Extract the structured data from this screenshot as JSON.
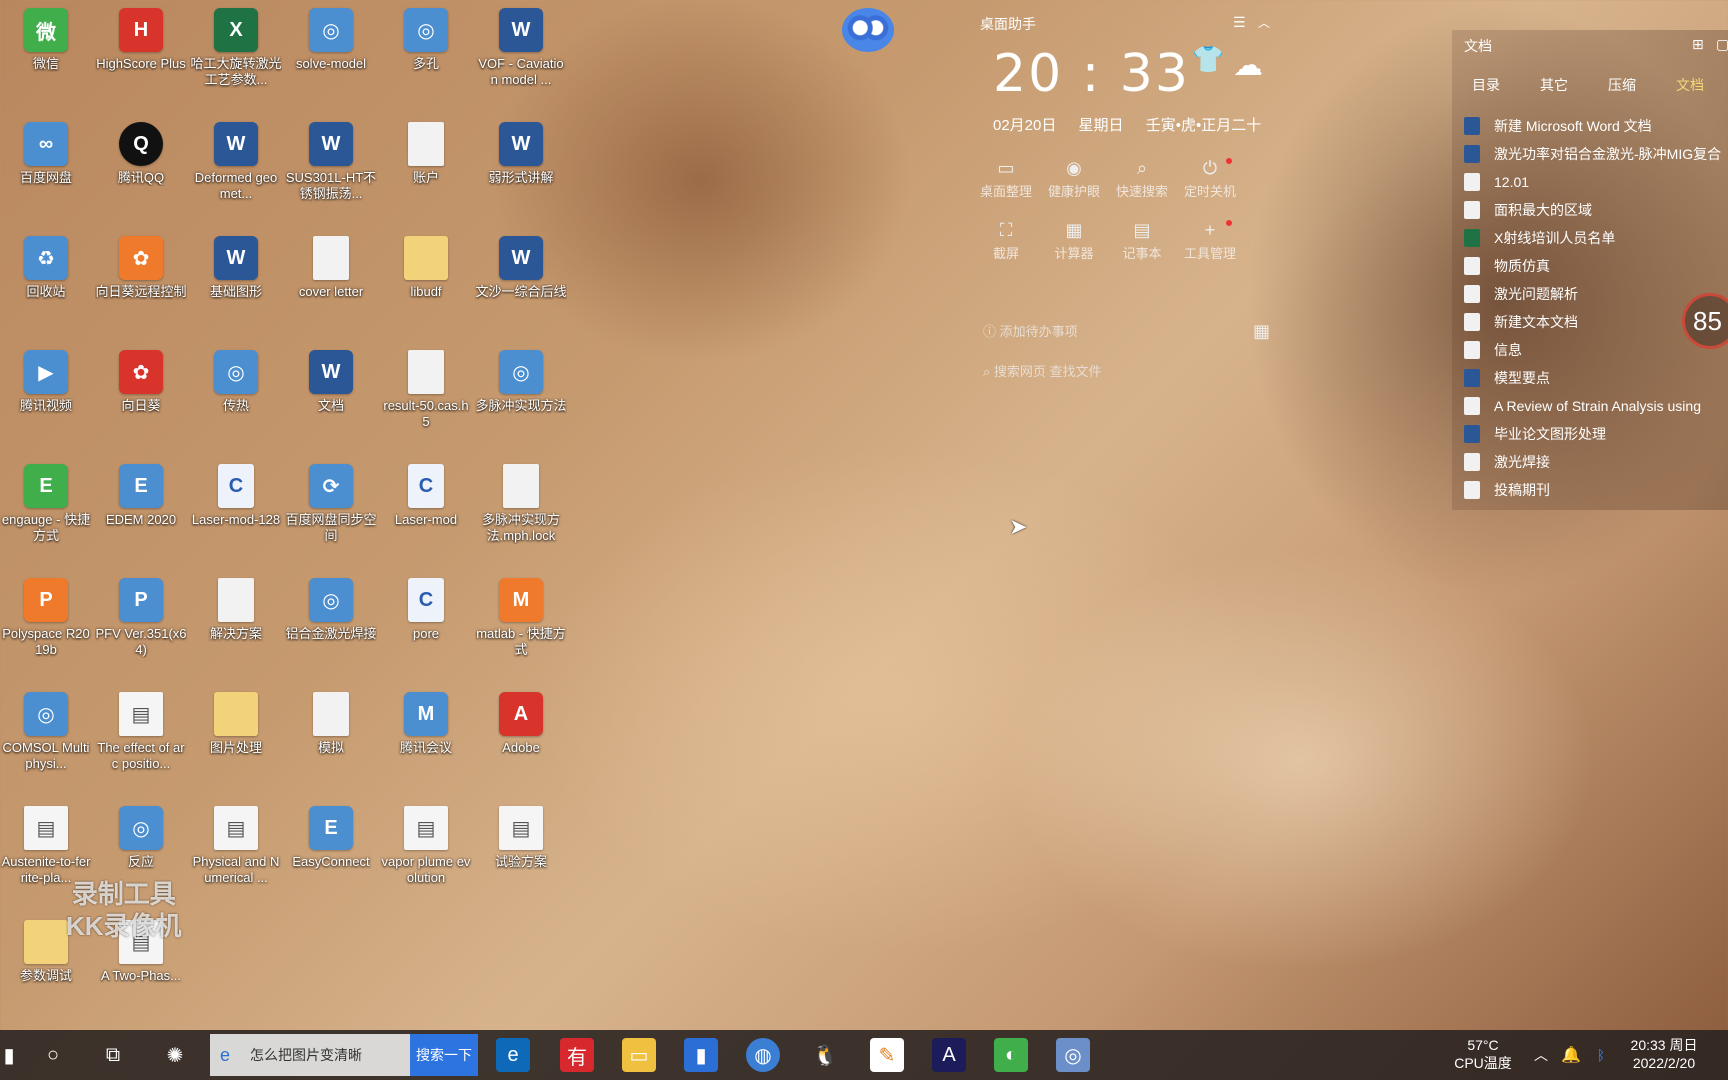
{
  "desktop": {
    "icons": [
      {
        "label": "微信",
        "glyph": "微",
        "kind": "green"
      },
      {
        "label": "HighScore Plus",
        "glyph": "H",
        "kind": "red"
      },
      {
        "label": "哈工大旋转激光工艺参数...",
        "glyph": "X",
        "kind": "excel"
      },
      {
        "label": "solve-model",
        "glyph": "◎",
        "kind": "app"
      },
      {
        "label": "多孔",
        "glyph": "◎",
        "kind": "app"
      },
      {
        "label": "VOF - Caviation model ...",
        "glyph": "W",
        "kind": "word"
      },
      {
        "label": "百度网盘",
        "glyph": "∞",
        "kind": "app"
      },
      {
        "label": "腾讯QQ",
        "glyph": "Q",
        "kind": "qq"
      },
      {
        "label": "Deformed geomet...",
        "glyph": "W",
        "kind": "word"
      },
      {
        "label": "SUS301L-HT不锈钢振荡...",
        "glyph": "W",
        "kind": "word"
      },
      {
        "label": "账户",
        "glyph": "",
        "kind": "blank"
      },
      {
        "label": "弱形式讲解",
        "glyph": "W",
        "kind": "word"
      },
      {
        "label": "回收站",
        "glyph": "♻",
        "kind": "app"
      },
      {
        "label": "向日葵远程控制",
        "glyph": "✿",
        "kind": "orange"
      },
      {
        "label": "基础图形",
        "glyph": "W",
        "kind": "word"
      },
      {
        "label": "cover letter",
        "glyph": "",
        "kind": "blank"
      },
      {
        "label": "libudf",
        "glyph": "",
        "kind": "folder"
      },
      {
        "label": "文沙一综合后线",
        "glyph": "W",
        "kind": "word"
      },
      {
        "label": "腾讯视频",
        "glyph": "▶",
        "kind": "app"
      },
      {
        "label": "向日葵",
        "glyph": "✿",
        "kind": "red"
      },
      {
        "label": "传热",
        "glyph": "◎",
        "kind": "app"
      },
      {
        "label": "文档",
        "glyph": "W",
        "kind": "word"
      },
      {
        "label": "result-50.cas.h5",
        "glyph": "",
        "kind": "blank"
      },
      {
        "label": "多脉冲实现方法",
        "glyph": "◎",
        "kind": "app"
      },
      {
        "label": "engauge - 快捷方式",
        "glyph": "E",
        "kind": "green"
      },
      {
        "label": "EDEM 2020",
        "glyph": "E",
        "kind": "app"
      },
      {
        "label": "Laser-mod-128",
        "glyph": "C",
        "kind": "c"
      },
      {
        "label": "百度网盘同步空间",
        "glyph": "⟳",
        "kind": "app"
      },
      {
        "label": "Laser-mod",
        "glyph": "C",
        "kind": "c"
      },
      {
        "label": "多脉冲实现方法.mph.lock",
        "glyph": "",
        "kind": "blank"
      },
      {
        "label": "Polyspace R2019b",
        "glyph": "P",
        "kind": "orange"
      },
      {
        "label": "PFV Ver.351(x64)",
        "glyph": "P",
        "kind": "app"
      },
      {
        "label": "解决方案",
        "glyph": "",
        "kind": "blank"
      },
      {
        "label": "铝合金激光焊接",
        "glyph": "◎",
        "kind": "app"
      },
      {
        "label": "pore",
        "glyph": "C",
        "kind": "c"
      },
      {
        "label": "matlab - 快捷方式",
        "glyph": "M",
        "kind": "orange"
      },
      {
        "label": "COMSOL Multiphysi...",
        "glyph": "◎",
        "kind": "app"
      },
      {
        "label": "The effect of arc positio...",
        "glyph": "▤",
        "kind": "doc"
      },
      {
        "label": "图片处理",
        "glyph": "",
        "kind": "folder"
      },
      {
        "label": "模拟",
        "glyph": "",
        "kind": "blank"
      },
      {
        "label": "腾讯会议",
        "glyph": "M",
        "kind": "app"
      },
      {
        "label": "Adobe",
        "glyph": "A",
        "kind": "red"
      },
      {
        "label": "Austenite-to-ferrite-pla...",
        "glyph": "▤",
        "kind": "doc"
      },
      {
        "label": "反应",
        "glyph": "◎",
        "kind": "app"
      },
      {
        "label": "Physical and Numerical ...",
        "glyph": "▤",
        "kind": "doc"
      },
      {
        "label": "EasyConnect",
        "glyph": "E",
        "kind": "app"
      },
      {
        "label": "vapor plume evolution",
        "glyph": "▤",
        "kind": "doc"
      },
      {
        "label": "试验方案",
        "glyph": "▤",
        "kind": "doc"
      },
      {
        "label": "参数调试",
        "glyph": "",
        "kind": "folder"
      },
      {
        "label": "A Two-Phas...",
        "glyph": "▤",
        "kind": "doc"
      }
    ]
  },
  "assistant": {
    "title": "桌面助手",
    "time": "20 : 33",
    "date": "02月20日",
    "weekday": "星期日",
    "lunar": "壬寅•虎•正月二十",
    "tools": [
      {
        "label": "桌面整理",
        "icon": "▭"
      },
      {
        "label": "健康护眼",
        "icon": "◉"
      },
      {
        "label": "快速搜索",
        "icon": "⌕"
      },
      {
        "label": "定时关机",
        "icon": "⏻"
      },
      {
        "label": "截屏",
        "icon": "⛶"
      },
      {
        "label": "计算器",
        "icon": "▦"
      },
      {
        "label": "记事本",
        "icon": "▤"
      },
      {
        "label": "工具管理",
        "icon": "+"
      }
    ],
    "todo": "添加待办事项",
    "search": "搜索网页  查找文件"
  },
  "docpanel": {
    "title": "文档",
    "tabs": [
      "目录",
      "其它",
      "压缩",
      "文档"
    ],
    "items": [
      {
        "label": "新建 Microsoft Word 文档",
        "type": "w"
      },
      {
        "label": "激光功率对铝合金激光-脉冲MIG复合",
        "type": "w"
      },
      {
        "label": "12.01",
        "type": "b"
      },
      {
        "label": "面积最大的区域",
        "type": "b"
      },
      {
        "label": "X射线培训人员名单",
        "type": "x"
      },
      {
        "label": "物质仿真",
        "type": "b"
      },
      {
        "label": "激光问题解析",
        "type": "b"
      },
      {
        "label": "新建文本文档",
        "type": "b"
      },
      {
        "label": "信息",
        "type": "b"
      },
      {
        "label": "模型要点",
        "type": "w"
      },
      {
        "label": "A Review of Strain Analysis using",
        "type": "b"
      },
      {
        "label": "毕业论文图形处理",
        "type": "w"
      },
      {
        "label": "激光焊接",
        "type": "b"
      },
      {
        "label": "投稿期刊",
        "type": "b"
      }
    ],
    "speed": "85"
  },
  "watermark": {
    "line1": "录制工具",
    "line2": "KK录像机"
  },
  "taskbar": {
    "search_text": "怎么把图片变清晰",
    "search_button": "搜索一下",
    "temp": "57°C",
    "temp_label": "CPU温度",
    "time": "20:33 周日",
    "date": "2022/2/20"
  }
}
